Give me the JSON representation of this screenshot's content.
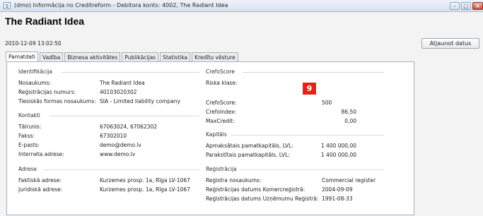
{
  "window": {
    "title": "(dmo) Informācija no Creditreform - Debitora konts: 4002, The Radiant Idea",
    "controls": {
      "minimize": "–",
      "maximize": "□",
      "close": "×"
    }
  },
  "header": {
    "company_name": "The Radiant Idea",
    "timestamp": "2010-12-09 13:02:50"
  },
  "toolbar": {
    "refresh_label": "Atjaunot datus"
  },
  "tabs": [
    {
      "label": "Pamatdati",
      "active": true
    },
    {
      "label": "Vadība",
      "active": false
    },
    {
      "label": "Biznesa aktivitātes",
      "active": false
    },
    {
      "label": "Publikācijas",
      "active": false
    },
    {
      "label": "Statistika",
      "active": false
    },
    {
      "label": "Kredītu vēsture",
      "active": false
    }
  ],
  "identification": {
    "heading": "Identifikācija",
    "name_label": "Nosaukums:",
    "name_value": "The Radiant Idea",
    "regno_label": "Reģistrācijas numurs:",
    "regno_value": "40103020302",
    "legal_label": "Tiesiskās formas nosaukums:",
    "legal_value": "SIA - Limited liability company"
  },
  "contacts": {
    "heading": "Kontakti",
    "phone_label": "Tālrunis:",
    "phone_value": "67063024, 67062302",
    "fax_label": "Fakss:",
    "fax_value": "67302010",
    "email_label": "E-pasts:",
    "email_value": "demo@demo.lv",
    "web_label": "Interneta adrese:",
    "web_value": "www.demo.lv"
  },
  "address": {
    "heading": "Adrese",
    "actual_label": "Faktiskā adrese:",
    "actual_value": "Kurzemes prosp. 1a, Rīga LV-1067",
    "legal_label": "Juridiskā adrese:",
    "legal_value": "Kurzemes prosp. 1a, Rīga LV-1067"
  },
  "crefo": {
    "heading": "CrefoScore",
    "risk_label": "Riska klase:",
    "risk_value": "9",
    "risk_color": "#e5221a",
    "score_label": "CrefoScore:",
    "score_value": "500",
    "index_label": "CrefoIndex:",
    "index_value": "86,50",
    "maxcredit_label": "MaxCredit:",
    "maxcredit_value": "0,00"
  },
  "capital": {
    "heading": "Kapitāls",
    "paid_label": "Apmaksātais pamatkapitāls, LVL:",
    "paid_value": "1 400 000,00",
    "signed_label": "Parakstītais pamatkapitāls, LVL:",
    "signed_value": "1 400 000,00"
  },
  "registration": {
    "heading": "Reģistrācija",
    "registry_label": "Reģistra nosaukums:",
    "registry_value": "Commercial register",
    "comm_date_label": "Reģistrācijas datums Komercreģistrā:",
    "comm_date_value": "2004-09-09",
    "ent_date_label": "Reģistrācijas datums Uzņēmumu Reģistrā:",
    "ent_date_value": "1991-08-33"
  }
}
